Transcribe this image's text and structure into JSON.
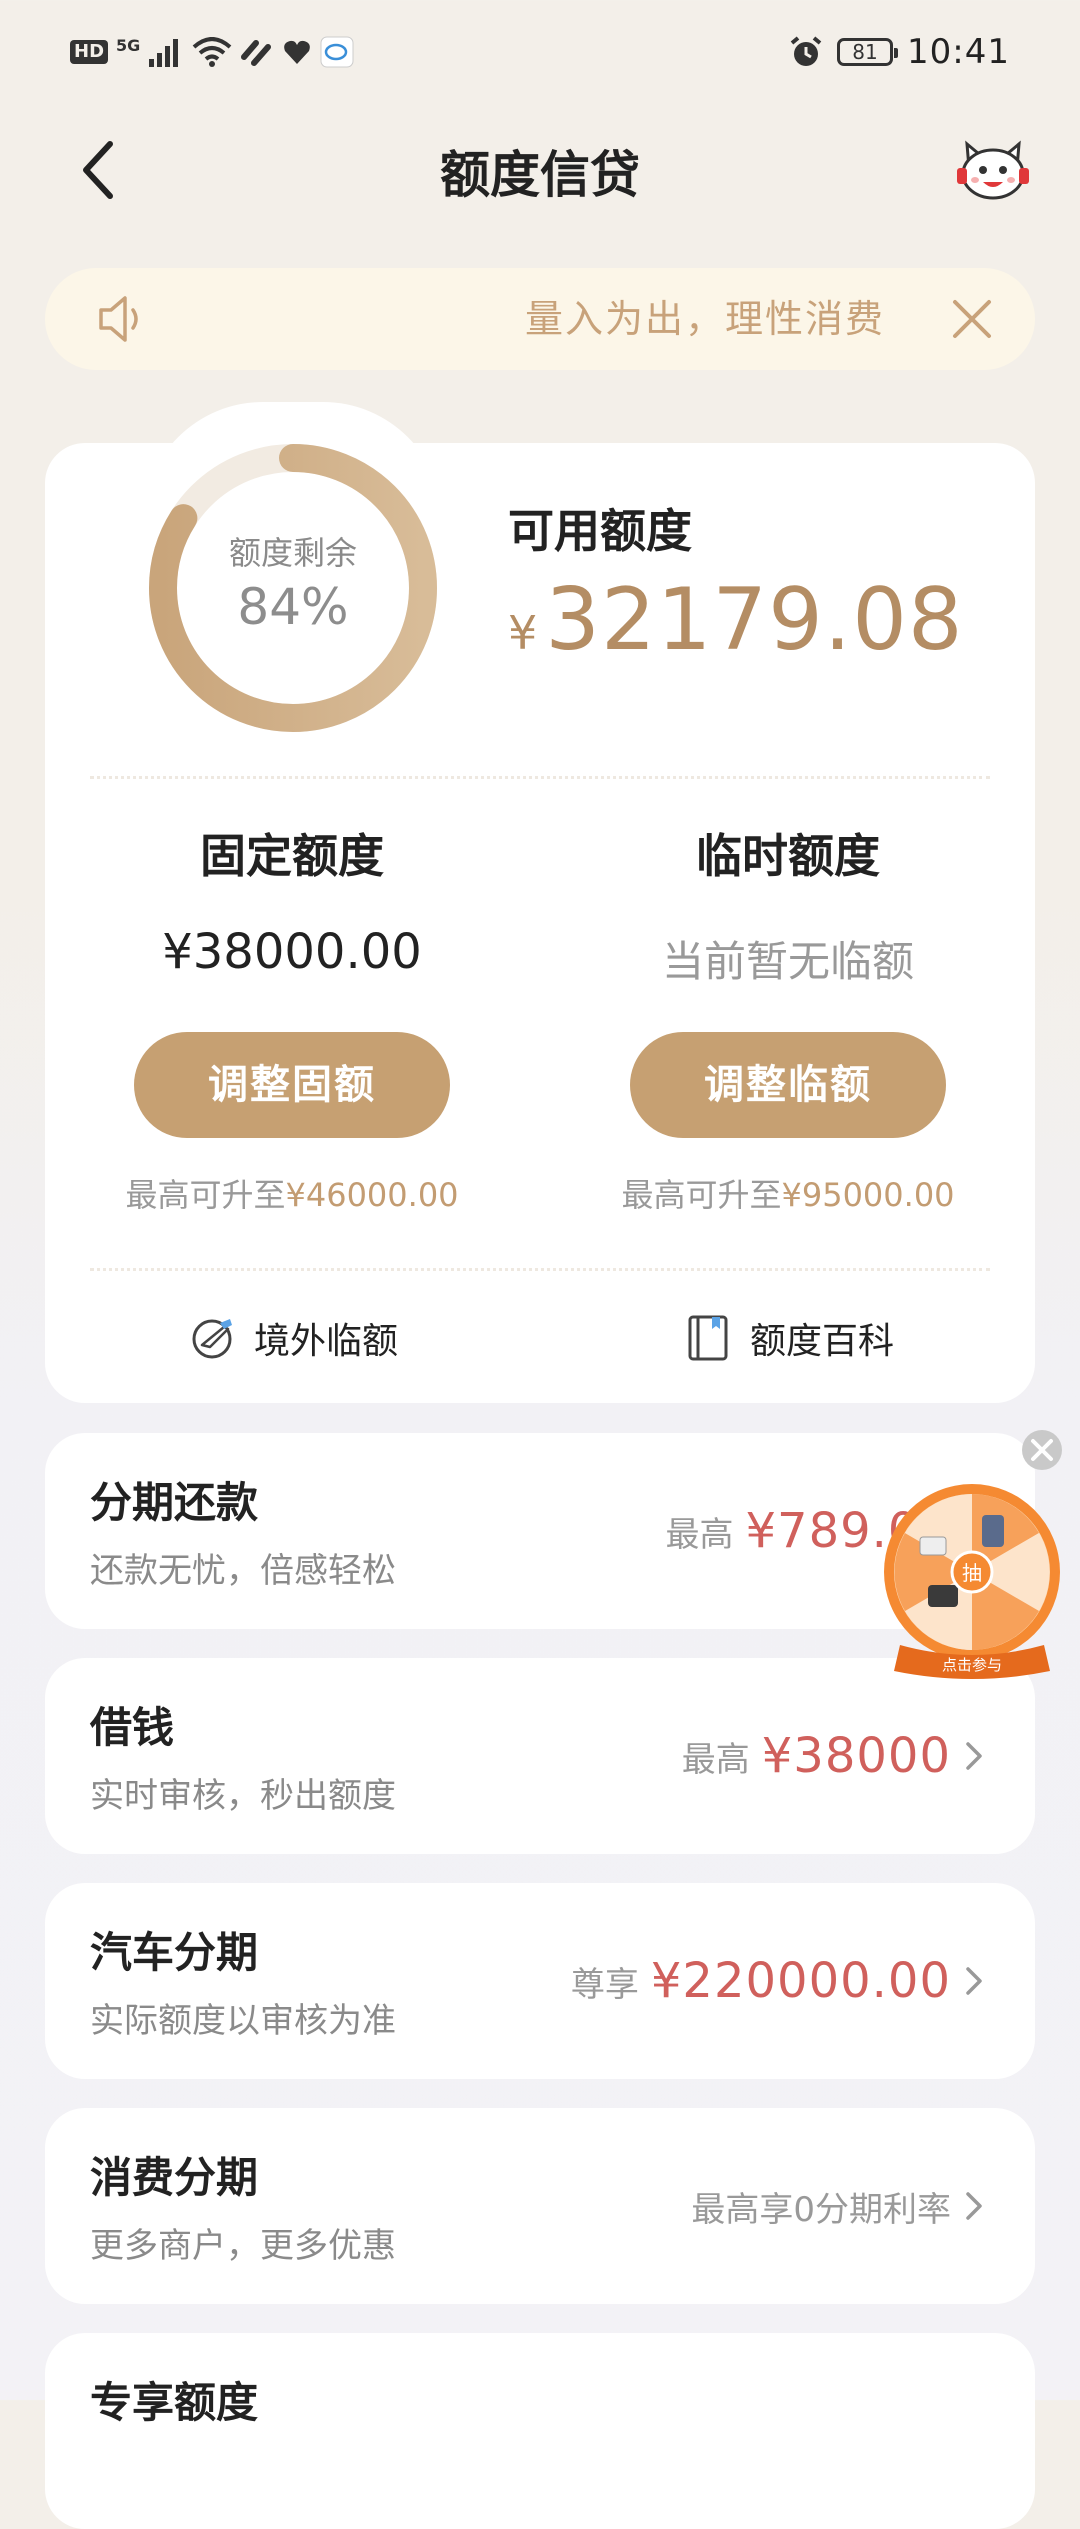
{
  "status_bar": {
    "network_hd": "HD",
    "network_gen": "5G",
    "battery": "81",
    "time": "10:41"
  },
  "nav": {
    "title": "额度信贷",
    "icons": [
      "back-arrow-icon",
      "mascot-service-icon"
    ]
  },
  "notice": {
    "text": "量入为出，理性消费",
    "icons": [
      "speaker-icon",
      "close-icon"
    ]
  },
  "credit": {
    "ring_label": "额度剩余",
    "ring_value": "84%",
    "ring_fraction": 0.84,
    "available_label": "可用额度",
    "available_currency": "¥",
    "available_amount": "32179.08",
    "fixed": {
      "title": "固定额度",
      "value": "¥38000.00",
      "button": "调整固额",
      "hint_prefix": "最高可升至",
      "hint_amount": "¥46000.00"
    },
    "temporary": {
      "title": "临时额度",
      "value": "当前暂无临额",
      "button": "调整临额",
      "hint_prefix": "最高可升至",
      "hint_amount": "¥95000.00"
    },
    "links": [
      {
        "label": "境外临额",
        "icon": "plane-globe-icon"
      },
      {
        "label": "额度百科",
        "icon": "book-icon"
      }
    ]
  },
  "products": [
    {
      "title": "分期还款",
      "subtitle": "还款无忧，倍感轻松",
      "prefix": "最高",
      "amount": "¥789.00",
      "plain": ""
    },
    {
      "title": "借钱",
      "subtitle": "实时审核，秒出额度",
      "prefix": "最高",
      "amount": "¥38000",
      "plain": ""
    },
    {
      "title": "汽车分期",
      "subtitle": "实际额度以审核为准",
      "prefix": "尊享",
      "amount": "¥220000.00",
      "plain": ""
    },
    {
      "title": "消费分期",
      "subtitle": "更多商户，更多优惠",
      "prefix": "",
      "amount": "",
      "plain": "最高享0分期利率"
    },
    {
      "title": "专享额度",
      "subtitle": "",
      "prefix": "",
      "amount": "",
      "plain": ""
    }
  ],
  "lottery": {
    "center": "抽",
    "caption": "点击参与",
    "icons": [
      "prize-wheel-icon",
      "close-icon"
    ]
  },
  "colors": {
    "accent_gold": "#c6a072",
    "amount_gold": "#b48d64",
    "amount_red": "#d0605c",
    "notice_bg": "#fcf6e8"
  }
}
